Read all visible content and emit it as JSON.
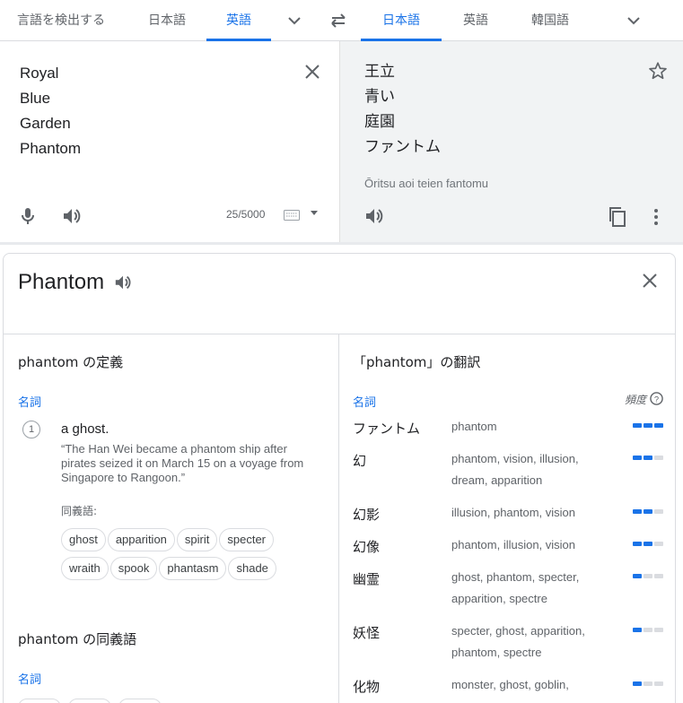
{
  "lang_bar": {
    "source_tabs": [
      {
        "label": "言語を検出する",
        "active": false
      },
      {
        "label": "日本語",
        "active": false
      },
      {
        "label": "英語",
        "active": true
      }
    ],
    "target_tabs": [
      {
        "label": "日本語",
        "active": true
      },
      {
        "label": "英語",
        "active": false
      },
      {
        "label": "韓国語",
        "active": false
      }
    ]
  },
  "source": {
    "lines": [
      "Royal",
      "Blue",
      "Garden",
      "Phantom"
    ],
    "char_count": "25/5000"
  },
  "target": {
    "lines": [
      "王立",
      "青い",
      "庭園",
      "ファントム"
    ],
    "romanization": "Ōritsu aoi teien fantomu"
  },
  "card": {
    "word": "Phantom",
    "definitions_title": "phantom の定義",
    "pos_noun": "名詞",
    "definition": {
      "number": "1",
      "text": "a ghost.",
      "example": "“The Han Wei became a phantom ship after pirates seized it on March 15 on a voyage from Singapore to Rangoon.”",
      "synonyms_label": "同義語:",
      "synonyms": [
        "ghost",
        "apparition",
        "spirit",
        "specter",
        "wraith",
        "spook",
        "phantasm",
        "shade"
      ]
    },
    "synonyms_title": "phantom の同義語",
    "synonyms_pos": "名詞",
    "translations_title": "「phantom」の翻訳",
    "translations_pos": "名詞",
    "frequency_label": "頻度",
    "translations": [
      {
        "word": "ファントム",
        "synonyms": "phantom",
        "frequency": 3
      },
      {
        "word": "幻",
        "synonyms": "phantom, vision, illusion, dream, apparition",
        "frequency": 2
      },
      {
        "word": "幻影",
        "synonyms": "illusion, phantom, vision",
        "frequency": 2
      },
      {
        "word": "幻像",
        "synonyms": "phantom, illusion, vision",
        "frequency": 2
      },
      {
        "word": "幽霊",
        "synonyms": "ghost, phantom, specter, apparition, spectre",
        "frequency": 1
      },
      {
        "word": "妖怪",
        "synonyms": "specter, ghost, apparition, phantom, spectre",
        "frequency": 1
      },
      {
        "word": "化物",
        "synonyms": "monster, ghost, goblin,",
        "frequency": 1
      }
    ]
  },
  "colors": {
    "accent": "#1a73e8",
    "muted": "#5f6368",
    "target_bg": "#f1f3f4"
  }
}
